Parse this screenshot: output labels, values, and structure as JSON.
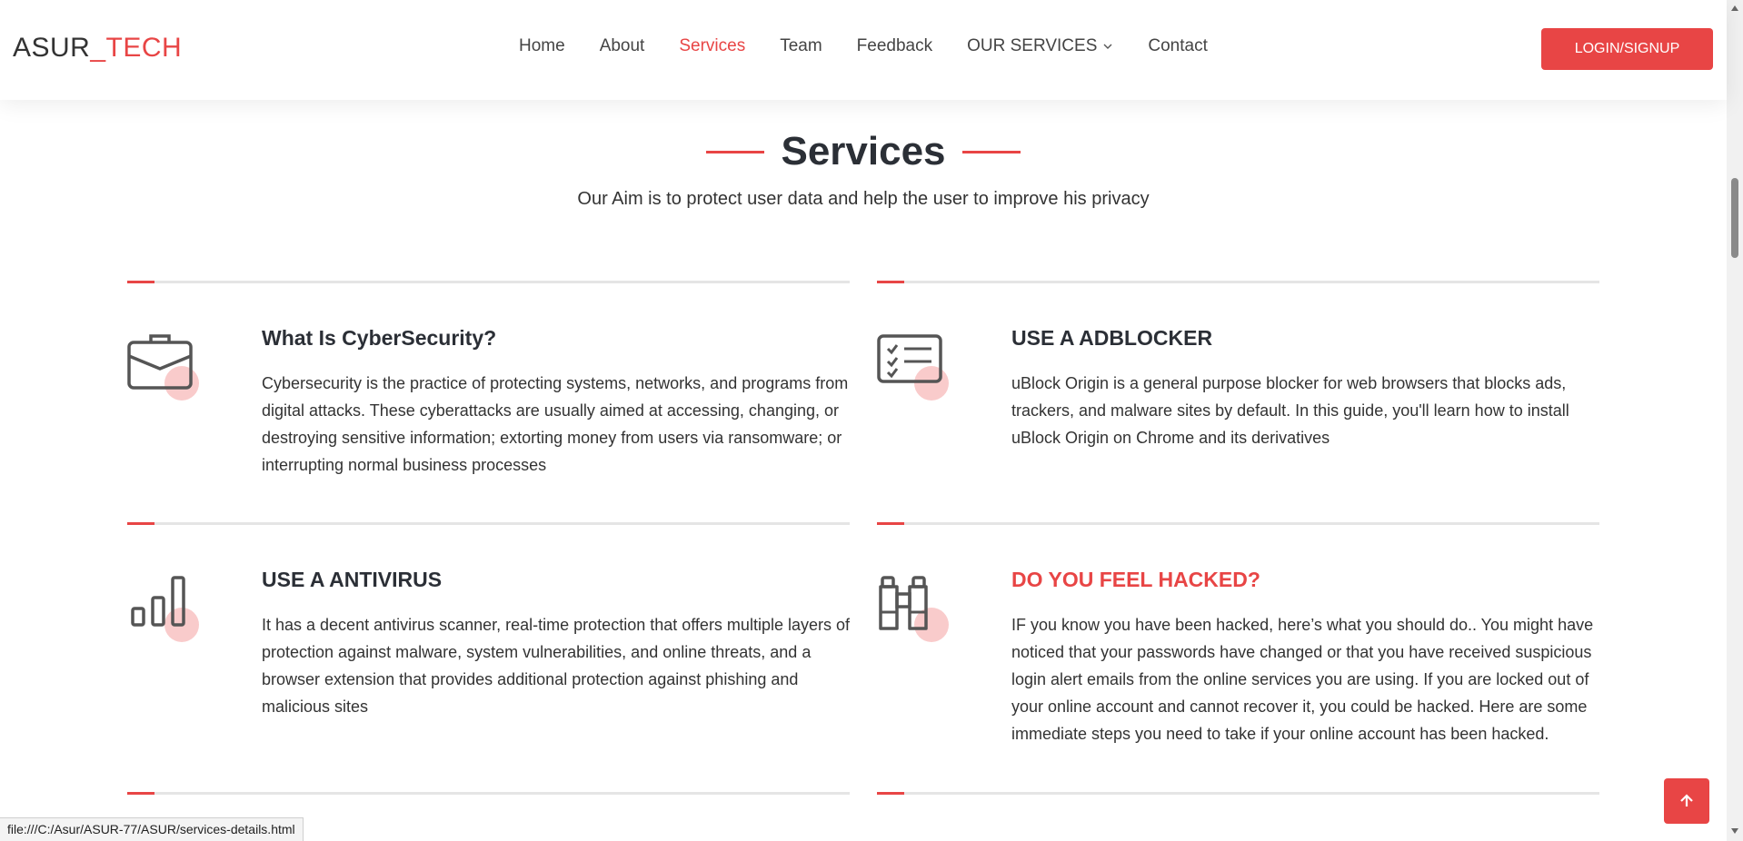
{
  "header": {
    "logo_main": "ASUR",
    "logo_accent": "_TECH",
    "nav": [
      {
        "label": "Home",
        "active": false
      },
      {
        "label": "About",
        "active": false
      },
      {
        "label": "Services",
        "active": true
      },
      {
        "label": "Team",
        "active": false
      },
      {
        "label": "Feedback",
        "active": false
      },
      {
        "label": "OUR SERVICES",
        "active": false,
        "dropdown": true
      },
      {
        "label": "Contact",
        "active": false
      }
    ],
    "login_label": "LOGIN/SIGNUP"
  },
  "section": {
    "title": "Services",
    "subtitle": "Our Aim is to protect user data and help the user to improve his privacy"
  },
  "services": [
    {
      "icon": "briefcase-icon",
      "title": "What Is CyberSecurity?",
      "highlight": false,
      "text": "Cybersecurity is the practice of protecting systems, networks, and programs from digital attacks. These cyberattacks are usually aimed at accessing, changing, or destroying sensitive information; extorting money from users via ransomware; or interrupting normal business processes"
    },
    {
      "icon": "card-checklist-icon",
      "title": "USE A ADBLOCKER",
      "highlight": false,
      "text": "uBlock Origin is a general purpose blocker for web browsers that blocks ads, trackers, and malware sites by default. In this guide, you'll learn how to install uBlock Origin on Chrome and its derivatives"
    },
    {
      "icon": "bar-chart-icon",
      "title": "USE A ANTIVIRUS",
      "highlight": false,
      "text": "It has a decent antivirus scanner, real-time protection that offers multiple layers of protection against malware, system vulnerabilities, and online threats, and a browser extension that provides additional protection against phishing and malicious sites"
    },
    {
      "icon": "binoculars-icon",
      "title": "DO YOU FEEL HACKED?",
      "highlight": true,
      "text": "IF you know you have been hacked, here’s what you should do.. You might have noticed that your passwords have changed or that you have received suspicious login alert emails from the online services you are using. If you are locked out of your online account and cannot recover it, you could be hacked. Here are some immediate steps you need to take if your online account has been hacked."
    }
  ],
  "status_url": "file:///C:/Asur/ASUR-77/ASUR/services-details.html",
  "colors": {
    "accent": "#e84545",
    "text": "#2b2f36"
  }
}
